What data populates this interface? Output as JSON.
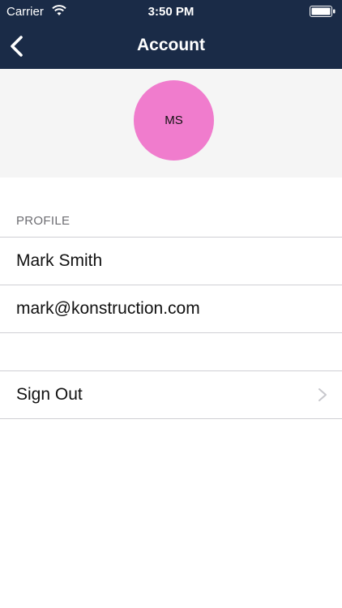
{
  "status_bar": {
    "carrier": "Carrier",
    "time": "3:50 PM",
    "icons": [
      "wifi-icon",
      "battery-icon"
    ]
  },
  "nav": {
    "title": "Account",
    "back_icon": "chevron-left-icon"
  },
  "avatar": {
    "initials": "MS",
    "color": "#f07ccd"
  },
  "profile": {
    "section_label": "PROFILE",
    "name": "Mark Smith",
    "email": "mark@konstruction.com"
  },
  "actions": {
    "sign_out_label": "Sign Out",
    "sign_out_icon": "chevron-right-icon"
  },
  "colors": {
    "nav_background": "#1a2b47",
    "avatar_background": "#f07ccd",
    "section_background": "#f5f5f5"
  }
}
